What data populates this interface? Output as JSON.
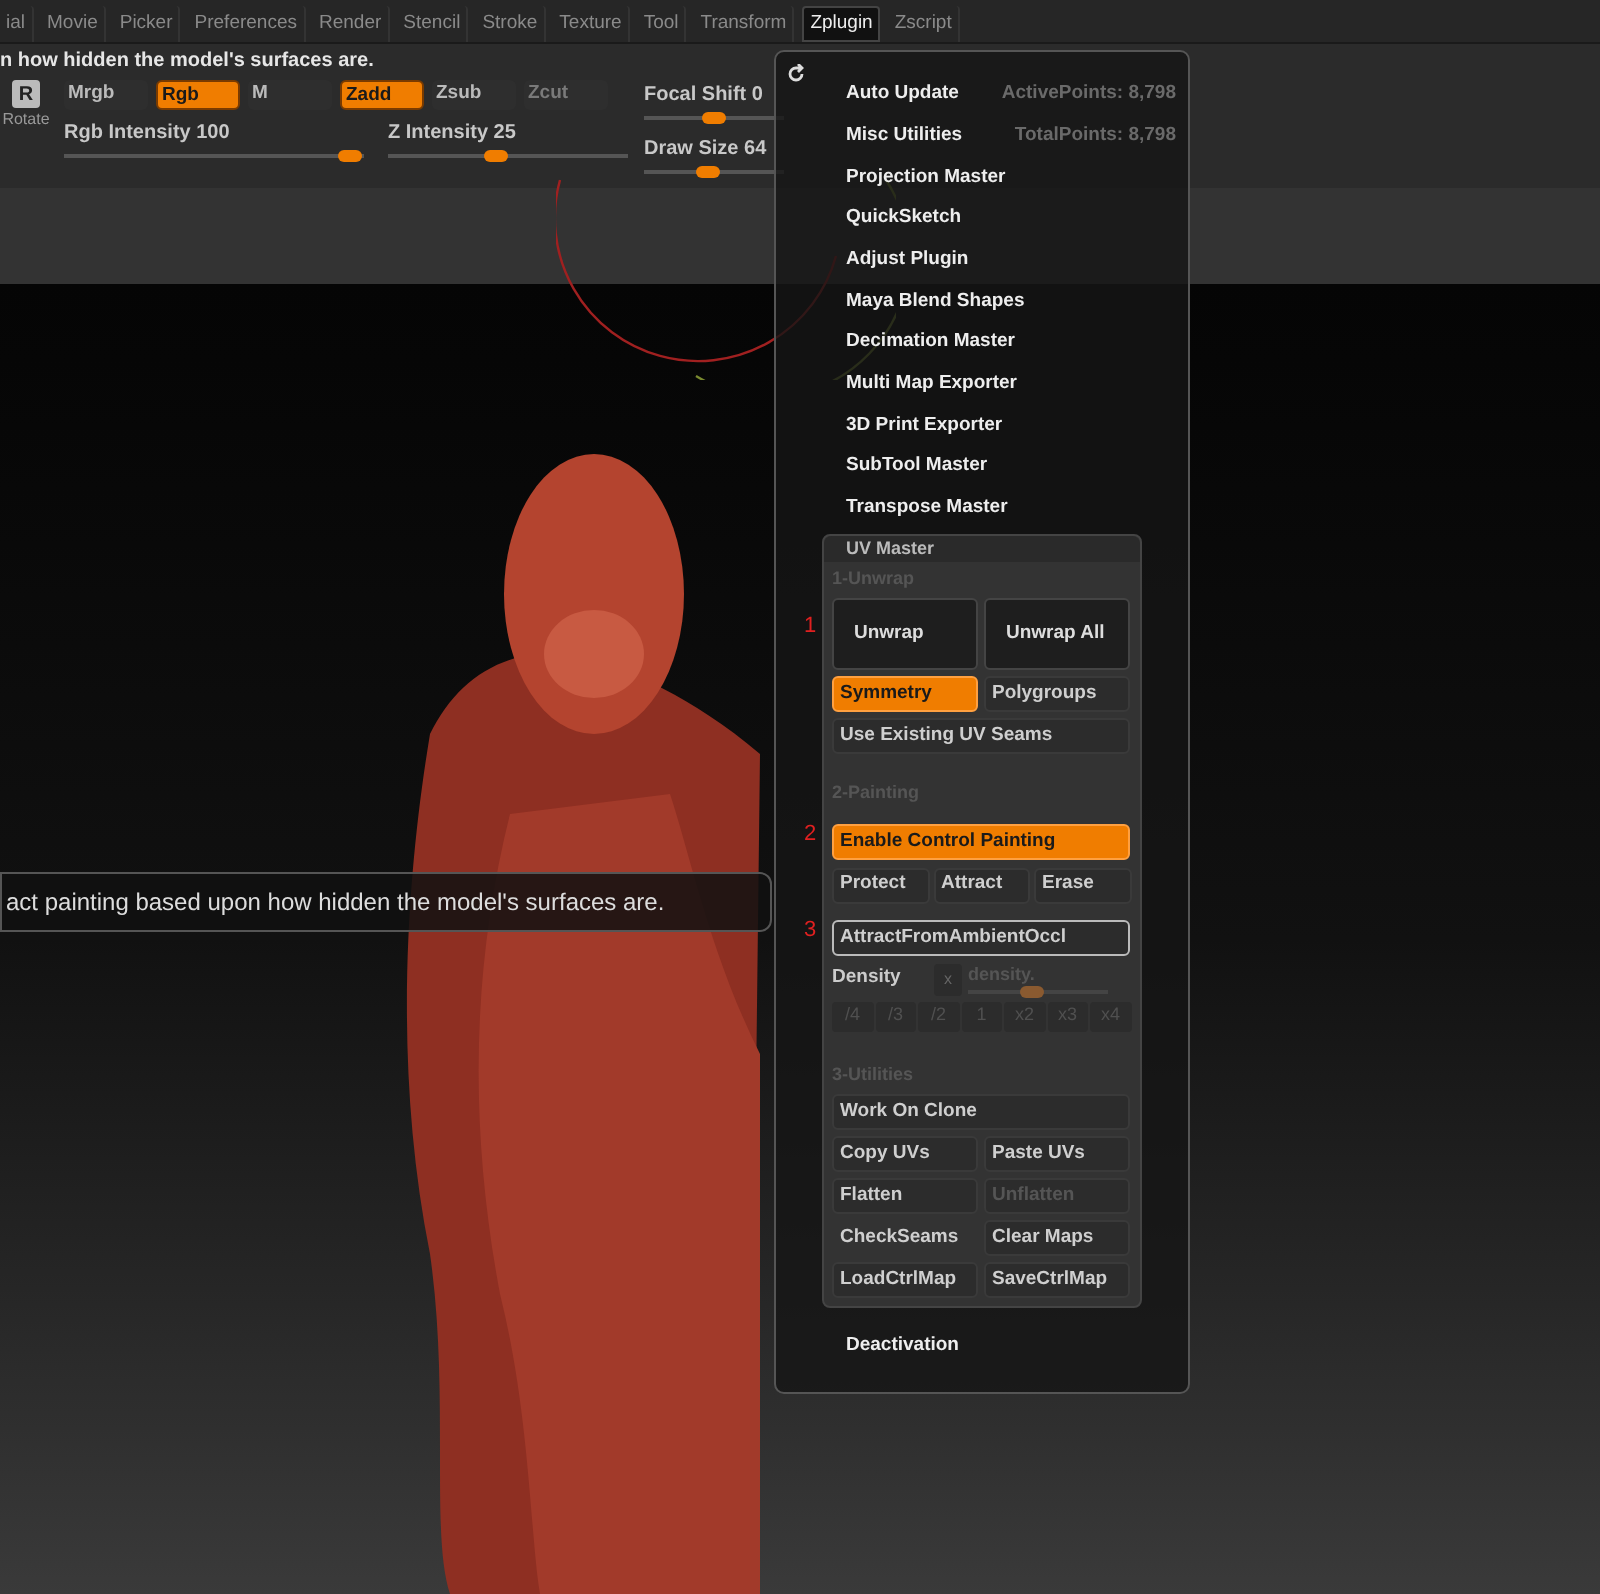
{
  "menu_bar": {
    "tabs": [
      {
        "label": "ial",
        "selected": false
      },
      {
        "label": "Movie",
        "selected": false
      },
      {
        "label": "Picker",
        "selected": false
      },
      {
        "label": "Preferences",
        "selected": false
      },
      {
        "label": "Render",
        "selected": false
      },
      {
        "label": "Stencil",
        "selected": false
      },
      {
        "label": "Stroke",
        "selected": false
      },
      {
        "label": "Texture",
        "selected": false
      },
      {
        "label": "Tool",
        "selected": false
      },
      {
        "label": "Transform",
        "selected": false
      },
      {
        "label": "Zplugin",
        "selected": true
      },
      {
        "label": "Zscript",
        "selected": false
      }
    ]
  },
  "info_line": "n how hidden the model's surfaces are.",
  "toolbar": {
    "rotate": {
      "key": "R",
      "label": "Rotate"
    },
    "modes": [
      {
        "label": "Mrgb",
        "on": false,
        "disabled": false
      },
      {
        "label": "Rgb",
        "on": true,
        "disabled": false
      },
      {
        "label": "M",
        "on": false,
        "disabled": false
      },
      {
        "label": "Zadd",
        "on": true,
        "disabled": false
      },
      {
        "label": "Zsub",
        "on": false,
        "disabled": false
      },
      {
        "label": "Zcut",
        "on": false,
        "disabled": true
      }
    ],
    "sliders": [
      {
        "label": "Rgb Intensity",
        "value": "100",
        "level": 0.95
      },
      {
        "label": "Z Intensity",
        "value": "25",
        "level": 0.45
      },
      {
        "label": "Focal Shift",
        "value": "0",
        "level": 0.5
      },
      {
        "label": "Draw Size",
        "value": "64",
        "level": 0.45
      }
    ],
    "points": [
      "ActivePoints: 8,798",
      "TotalPoints: 8,798"
    ]
  },
  "tooltip": "act painting based upon how hidden the model's surfaces are.",
  "zplugin_menu": {
    "items": [
      "Auto Update",
      "Misc Utilities",
      "Projection Master",
      "QuickSketch",
      "Adjust Plugin",
      "Maya Blend Shapes",
      "Decimation Master",
      "Multi Map Exporter",
      "3D Print Exporter",
      "SubTool Master",
      "Transpose Master"
    ],
    "uv_master": {
      "title": "UV Master",
      "unwrap": {
        "heading": "1-Unwrap",
        "marker": "1",
        "buttons": [
          "Unwrap",
          "Unwrap All"
        ],
        "options": [
          {
            "label": "Symmetry",
            "on": true
          },
          {
            "label": "Polygroups",
            "on": false
          }
        ],
        "use_seams": {
          "label": "Use Existing UV Seams",
          "on": false
        }
      },
      "painting": {
        "heading": "2-Painting",
        "enable": {
          "marker": "2",
          "label": "Enable Control Painting",
          "on": true
        },
        "modes": [
          "Protect",
          "Attract",
          "Erase"
        ],
        "ambient": {
          "marker": "3",
          "label": "AttractFromAmbientOccl",
          "hovered": true
        },
        "density": {
          "label": "Density",
          "reset": "x",
          "placeholder": "density.",
          "level": 0.45
        },
        "multipliers": [
          {
            "label": "/4",
            "disabled": true
          },
          {
            "label": "/3",
            "disabled": true
          },
          {
            "label": "/2",
            "disabled": true
          },
          {
            "label": "1",
            "disabled": true
          },
          {
            "label": "x2",
            "disabled": true
          },
          {
            "label": "x3",
            "disabled": true
          },
          {
            "label": "x4",
            "disabled": true
          }
        ]
      },
      "utilities": {
        "heading": "3-Utilities",
        "buttons": [
          {
            "label": "Work On Clone",
            "kind": "wide",
            "disabled": false
          },
          {
            "label": "Copy UVs",
            "kind": "half",
            "disabled": false
          },
          {
            "label": "Paste UVs",
            "kind": "half",
            "disabled": false
          },
          {
            "label": "Flatten",
            "kind": "half",
            "disabled": false
          },
          {
            "label": "Unflatten",
            "kind": "half",
            "disabled": true
          },
          {
            "label": "CheckSeams",
            "kind": "flat",
            "disabled": false
          },
          {
            "label": "Clear Maps",
            "kind": "half",
            "disabled": false
          },
          {
            "label": "LoadCtrlMap",
            "kind": "half",
            "disabled": false
          },
          {
            "label": "SaveCtrlMap",
            "kind": "half",
            "disabled": false
          }
        ]
      }
    },
    "footer_item": "Deactivation"
  }
}
